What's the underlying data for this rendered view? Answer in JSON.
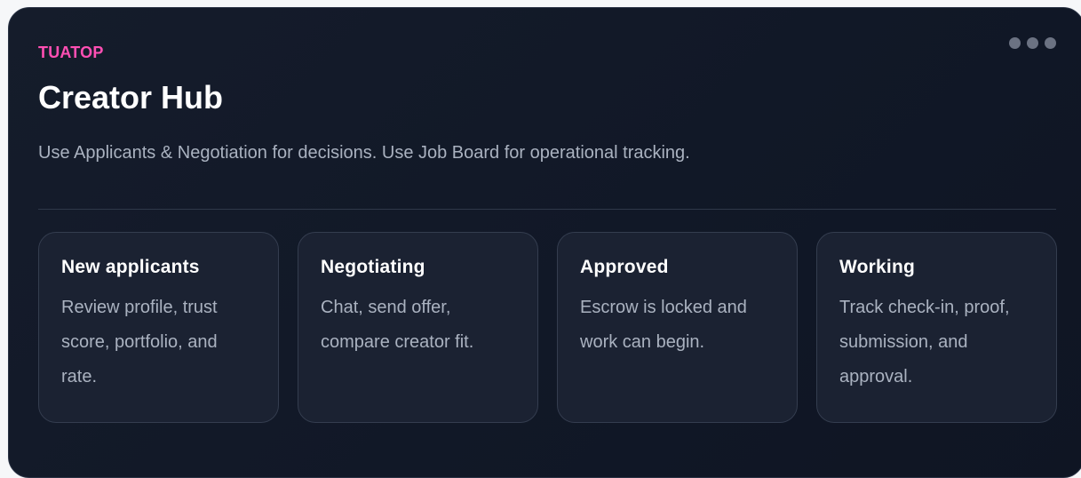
{
  "header": {
    "brand": "TUATOP",
    "title": "Creator Hub",
    "subtitle": "Use Applicants & Negotiation for decisions. Use Job Board for operational tracking."
  },
  "stages": [
    {
      "title": "New applicants",
      "description": "Review profile, trust score, portfolio, and rate."
    },
    {
      "title": "Negotiating",
      "description": "Chat, send offer, compare creator fit."
    },
    {
      "title": "Approved",
      "description": "Escrow is locked and work can begin."
    },
    {
      "title": "Working",
      "description": "Track check-in, proof, submission, and approval."
    }
  ],
  "colors": {
    "brand_accent": "#ff4fb3",
    "panel_background": "#111827",
    "card_background": "#1b2232",
    "muted_text": "#aab2c0"
  },
  "icons": {
    "menu": "more-horizontal-icon"
  }
}
